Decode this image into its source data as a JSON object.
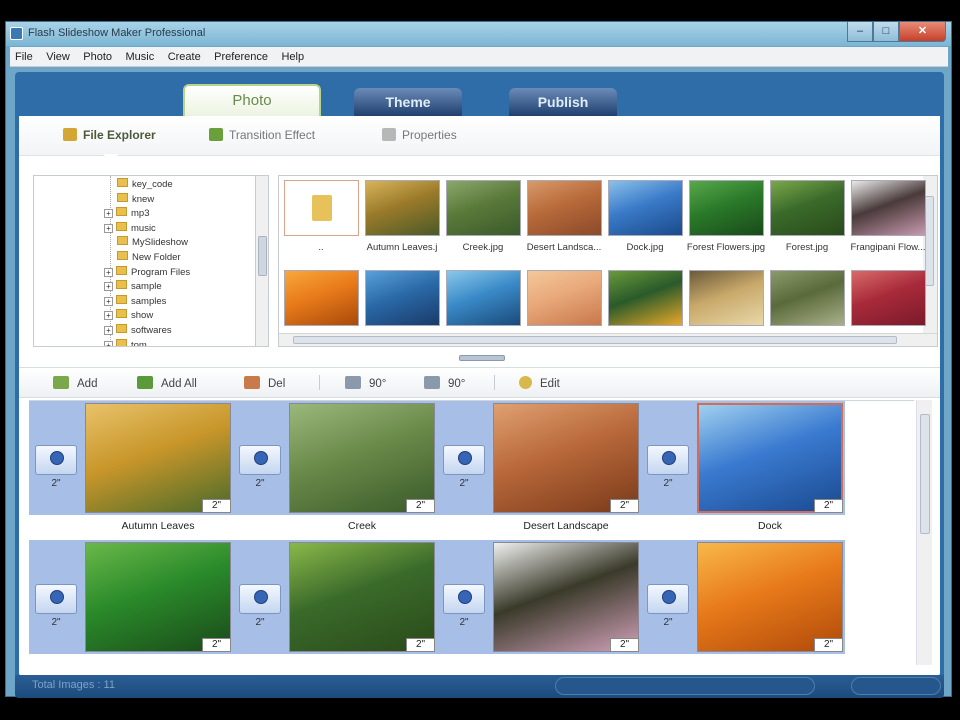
{
  "window": {
    "title": "Flash Slideshow Maker Professional",
    "minimize": "–",
    "maximize": "□",
    "close": "✕"
  },
  "menu": [
    "File",
    "View",
    "Photo",
    "Music",
    "Create",
    "Preference",
    "Help"
  ],
  "tabs": [
    {
      "label": "Photo",
      "active": true
    },
    {
      "label": "Theme",
      "active": false
    },
    {
      "label": "Publish",
      "active": false
    }
  ],
  "subtabs": [
    {
      "label": "File Explorer",
      "icon": "folder-icon",
      "active": true
    },
    {
      "label": "Transition Effect",
      "icon": "transition-icon",
      "active": false
    },
    {
      "label": "Properties",
      "icon": "properties-icon",
      "active": false
    }
  ],
  "tree": [
    {
      "label": "key_code",
      "expander": ""
    },
    {
      "label": "knew",
      "expander": ""
    },
    {
      "label": "mp3",
      "expander": "+"
    },
    {
      "label": "music",
      "expander": "+"
    },
    {
      "label": "MySlideshow",
      "expander": ""
    },
    {
      "label": "New Folder",
      "expander": ""
    },
    {
      "label": "Program Files",
      "expander": "+"
    },
    {
      "label": "sample",
      "expander": "+"
    },
    {
      "label": "samples",
      "expander": "+"
    },
    {
      "label": "show",
      "expander": "+"
    },
    {
      "label": "softwares",
      "expander": "+"
    },
    {
      "label": "tom",
      "expander": "+"
    }
  ],
  "thumbnails_row1": [
    {
      "caption": "..",
      "kind": "folder-up"
    },
    {
      "caption": "Autumn Leaves.j",
      "colors": [
        "#9a7a2a",
        "#d8b45a",
        "#4a5a28"
      ]
    },
    {
      "caption": "Creek.jpg",
      "colors": [
        "#5a7a3a",
        "#8aa86a",
        "#3a5a2a"
      ]
    },
    {
      "caption": "Desert Landsca...",
      "colors": [
        "#b86a3a",
        "#d89a6a",
        "#8a4a2a"
      ]
    },
    {
      "caption": "Dock.jpg",
      "colors": [
        "#3a7ac8",
        "#8ac0ea",
        "#1a4a8a"
      ]
    },
    {
      "caption": "Forest Flowers.jpg",
      "colors": [
        "#2a7a2a",
        "#5aa84a",
        "#1a4a1a"
      ]
    },
    {
      "caption": "Forest.jpg",
      "colors": [
        "#3a6a2a",
        "#7aa84a",
        "#2a4a1a"
      ]
    },
    {
      "caption": "Frangipani Flow...",
      "colors": [
        "#4a3a3a",
        "#eaeaea",
        "#c89ab0"
      ]
    }
  ],
  "thumbnails_row2": [
    {
      "colors": [
        "#e87a1a",
        "#f8a83a",
        "#a84a0a"
      ]
    },
    {
      "colors": [
        "#2a6aa8",
        "#5aa0d8",
        "#1a3a6a"
      ]
    },
    {
      "colors": [
        "#3a8ac8",
        "#8ac8ea",
        "#1a4a7a"
      ]
    },
    {
      "colors": [
        "#e8a87a",
        "#f4c89a",
        "#c8784a"
      ]
    },
    {
      "colors": [
        "#2a5a2a",
        "#6a9a3a",
        "#e8a82a"
      ]
    },
    {
      "colors": [
        "#c8a86a",
        "#6a5a3a",
        "#e8d8a8"
      ]
    },
    {
      "colors": [
        "#5a6a3a",
        "#8a9a6a",
        "#aab08a"
      ]
    },
    {
      "colors": [
        "#a82a3a",
        "#d86a6a",
        "#7a1a2a"
      ]
    }
  ],
  "toolbar": {
    "add": "Add",
    "add_all": "Add All",
    "del": "Del",
    "rotate_left": "90°",
    "rotate_right": "90°",
    "edit": "Edit"
  },
  "storyboard": {
    "transition_duration": "2\"",
    "slides": [
      {
        "caption": "Autumn Leaves",
        "duration": "2\"",
        "colors": [
          "#c8962a",
          "#e8c26a",
          "#4a6a2a"
        ],
        "selected": false
      },
      {
        "caption": "Creek",
        "duration": "2\"",
        "colors": [
          "#6a8a4a",
          "#9ab87a",
          "#3a5a2a"
        ],
        "selected": false
      },
      {
        "caption": "Desert Landscape",
        "duration": "2\"",
        "colors": [
          "#b8683a",
          "#e0a070",
          "#7a3a1a"
        ],
        "selected": false
      },
      {
        "caption": "Dock",
        "duration": "2\"",
        "colors": [
          "#3a7ad0",
          "#a0d0f0",
          "#1a4a90"
        ],
        "selected": true
      },
      {
        "caption": "",
        "duration": "2\"",
        "colors": [
          "#2a8a2a",
          "#6ab84a",
          "#1a4a1a"
        ],
        "selected": false
      },
      {
        "caption": "",
        "duration": "2\"",
        "colors": [
          "#3a6a2a",
          "#8ab84a",
          "#2a4a1a"
        ],
        "selected": false
      },
      {
        "caption": "",
        "duration": "2\"",
        "colors": [
          "#3a3a2a",
          "#f0f0f0",
          "#d0a0b8"
        ],
        "selected": false
      },
      {
        "caption": "",
        "duration": "2\"",
        "colors": [
          "#e87a1a",
          "#f8b84a",
          "#b04a0a"
        ],
        "selected": false
      }
    ]
  },
  "status": {
    "text": "Total Images : 11"
  }
}
